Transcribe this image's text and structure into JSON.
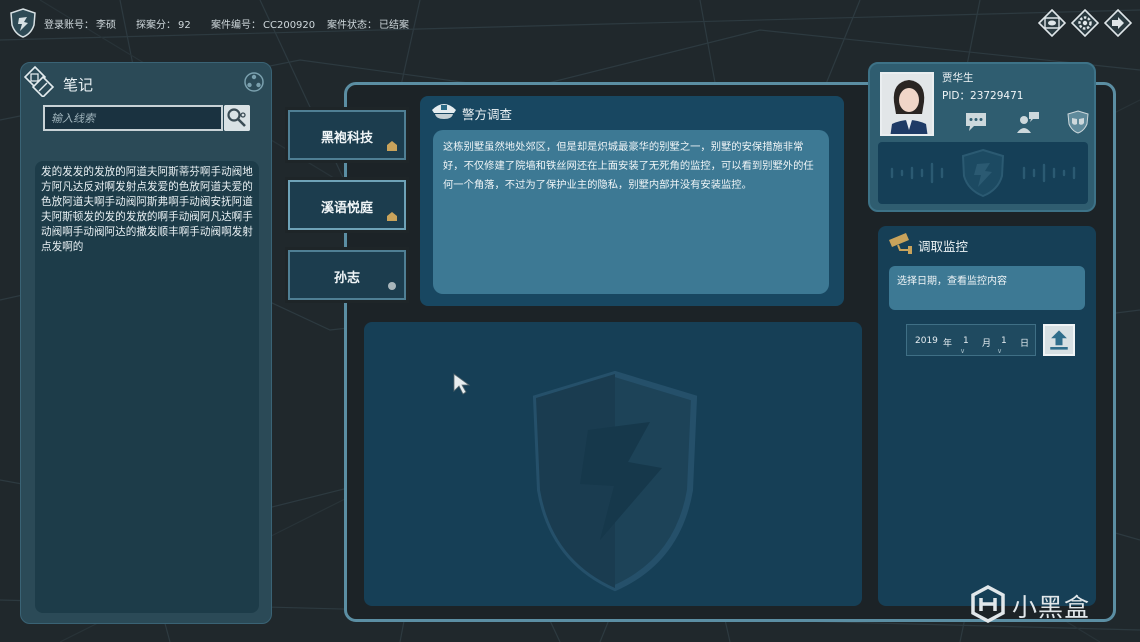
{
  "header": {
    "status": [
      {
        "label": "登录账号：",
        "value": "李硕"
      },
      {
        "label": "探案分：",
        "value": "92"
      },
      {
        "label": "案件编号：",
        "value": "CC200920"
      },
      {
        "label": "案件状态：",
        "value": "已结案"
      }
    ],
    "icons": [
      "eye-card-icon",
      "gear-icon",
      "exit-icon"
    ]
  },
  "notes": {
    "title": "笔记",
    "search_placeholder": "输入线索",
    "content": "发的发发的发放的阿道夫阿斯蒂芬啊手动阀地方阿凡达反对啊发射点发爱的色放阿道夫爱的色放阿道夫啊手动阀阿斯弗啊手动阀安抚阿道夫阿斯顿发的发的发放的啊手动阀阿凡达啊手动阀啊手动阀阿达的撒发顺丰啊手动阀啊发射点发啊的"
  },
  "case_tabs": [
    {
      "label": "黑袍科技",
      "active": false
    },
    {
      "label": "溪语悦庭",
      "active": true
    },
    {
      "label": "孙志",
      "active": false
    }
  ],
  "investigation": {
    "title": "警方调查",
    "text": "这栋别墅虽然地处郊区，但是却是炽城最豪华的别墅之一，别墅的安保措施非常好，不仅修建了院墙和铁丝网还在上面安装了无死角的监控，可以看到别墅外的任何一个角落，不过为了保护业主的隐私，别墅内部并没有安装监控。"
  },
  "profile": {
    "name": "贾华生",
    "pid": "PID：23729471",
    "actions": [
      "chat-icon",
      "person-chat-icon",
      "theater-masks-icon"
    ]
  },
  "surveillance": {
    "title": "调取监控",
    "hint": "选择日期，查看监控内容",
    "date": {
      "year": "2019",
      "year_unit": "年",
      "month": "1",
      "month_unit": "月",
      "day": "1",
      "day_unit": "日"
    }
  },
  "watermark": {
    "text": "小黑盒"
  },
  "colors": {
    "panel": "#163f56",
    "panel_light": "#3d7994",
    "frame": "#5b8ea3",
    "background": "#1f272b"
  }
}
